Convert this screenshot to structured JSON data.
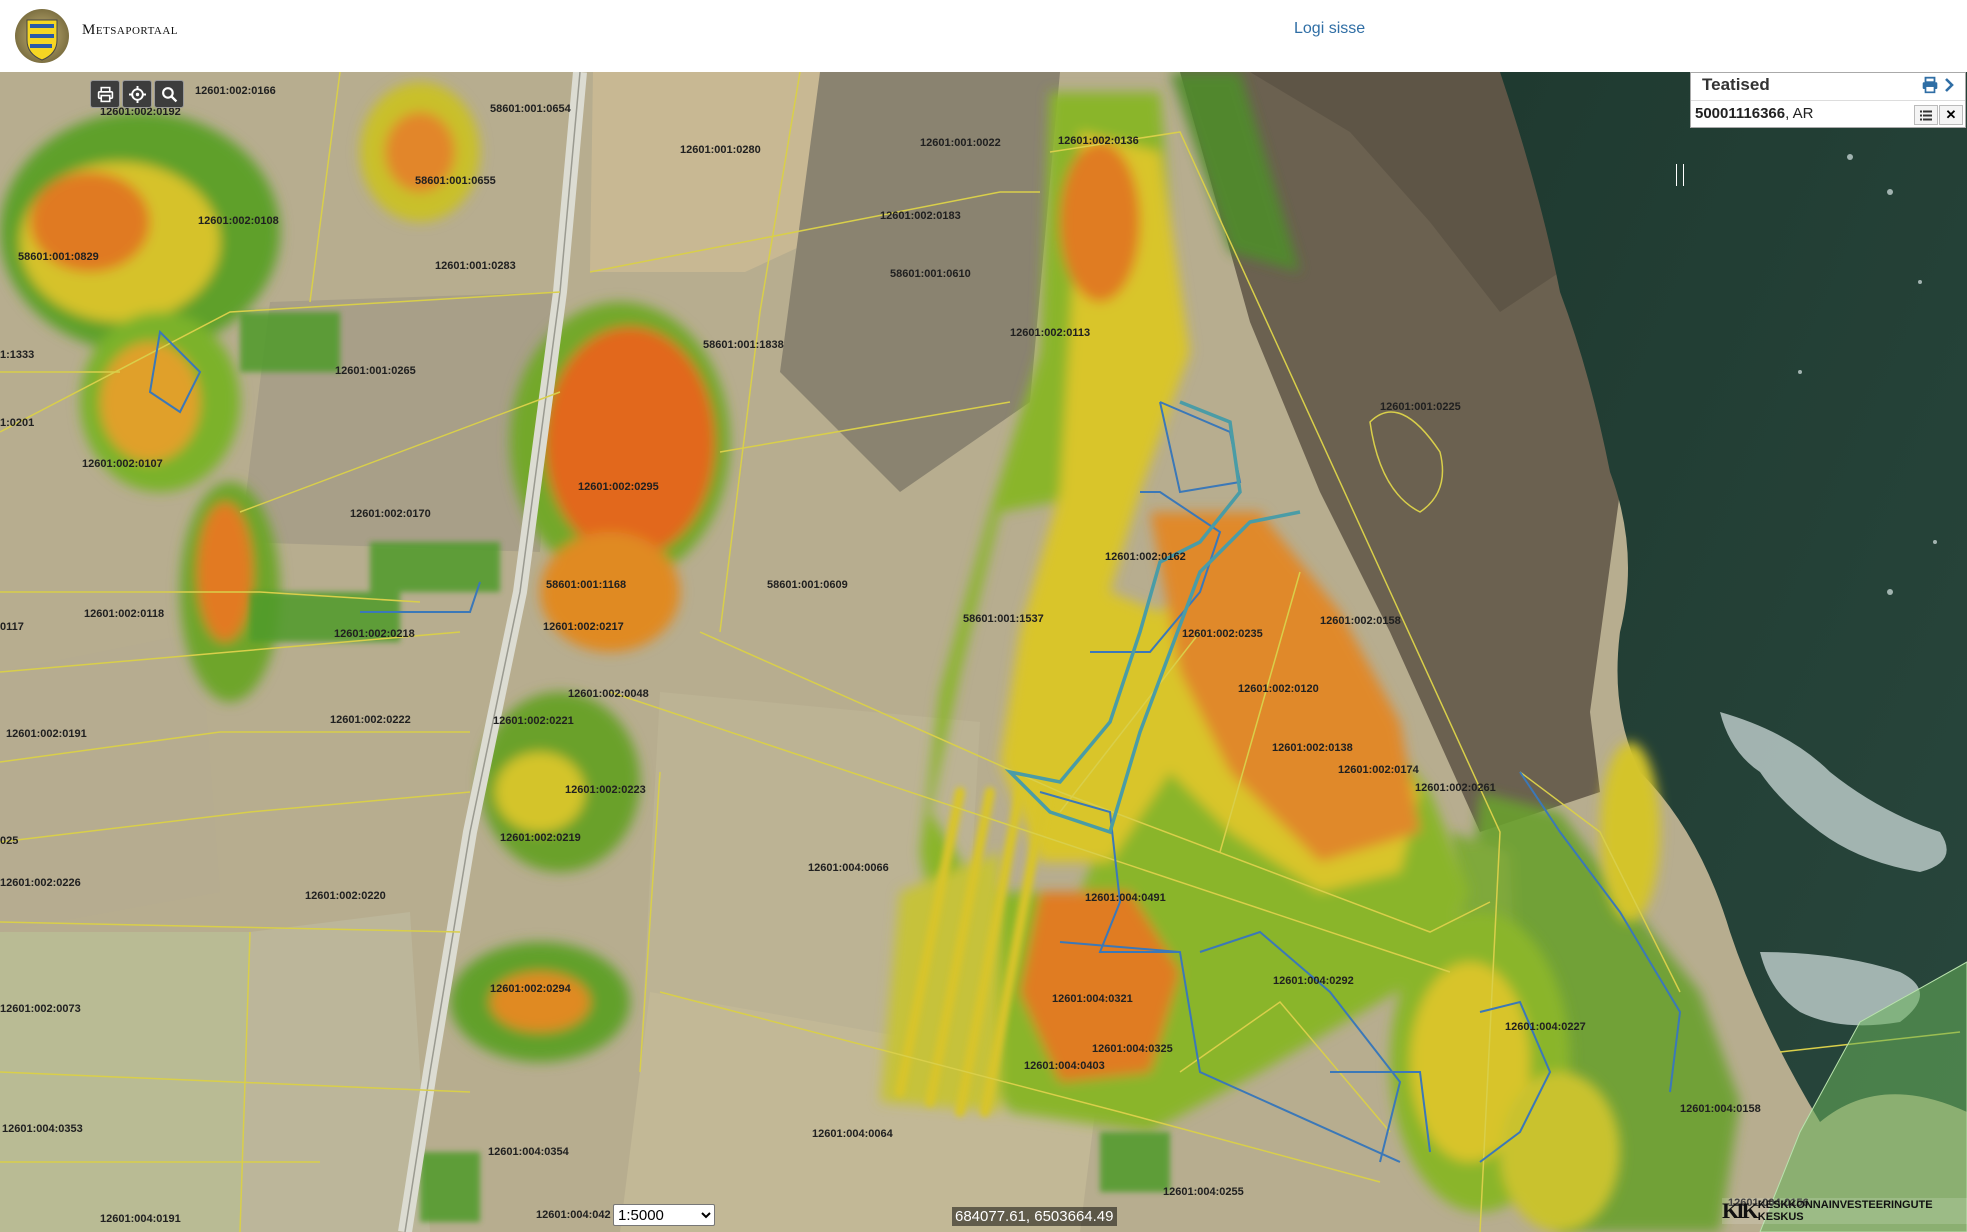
{
  "header": {
    "app_title": "Metsaportaal",
    "login_label": "Logi sisse",
    "logo_icon": "estonian-coat-of-arms-icon"
  },
  "toolbar": {
    "print_icon": "print-icon",
    "locate_icon": "crosshair-icon",
    "zoom_icon": "search-icon"
  },
  "notices_panel": {
    "title": "Teatised",
    "item_id": "50001116366",
    "item_suffix": ", AR"
  },
  "map": {
    "scale_options": [
      "1:5000"
    ],
    "scale_selected": "1:5000",
    "coordinates": "684077.61, 6503664.49",
    "credit": "KESKKONNAINVESTEERINGUTE KESKUS",
    "credit_logo": "KIK",
    "parcel_labels": [
      "12601:002:0166",
      "12601:002:0192",
      "58601:001:0654",
      "12601:001:0280",
      "12601:001:0022",
      "12601:002:0136",
      "58601:001:0655",
      "12601:002:0108",
      "58601:001:0829",
      "12601:001:0283",
      "12601:002:0183",
      "58601:001:0610",
      "12601:002:0113",
      "58601:001:1838",
      "12601:001:0265",
      "12601:001:0225",
      "12601:002:0107",
      "12601:002:0295",
      "12601:002:0170",
      "12601:002:0162",
      "58601:001:1168",
      "58601:001:0609",
      "12601:002:0118",
      "12601:002:0218",
      "12601:002:0217",
      "58601:001:1537",
      "12601:002:0235",
      "12601:002:0158",
      "12601:002:0120",
      "12601:002:0048",
      "12601:002:0222",
      "12601:002:0221",
      "12601:002:0191",
      "12601:002:0138",
      "12601:002:0174",
      "12601:002:0261",
      "12601:002:0223",
      "12601:004:0066",
      "12601:002:0219",
      "12601:004:0491",
      "12601:002:0220",
      "12601:004:0292",
      "12601:002:0294",
      "12601:004:0321",
      "12601:004:0227",
      "12601:004:0325",
      "12601:004:0403",
      "12601:004:0158",
      "12601:004:0353",
      "12601:004:0354",
      "12601:004:0064",
      "12601:004:0255",
      "12601:004:0191",
      "12601:004:042",
      "12601:004:0156",
      "12601:002:0073",
      "12601:002:0226",
      "1:1333",
      "1:0201",
      "0117",
      "025"
    ]
  }
}
